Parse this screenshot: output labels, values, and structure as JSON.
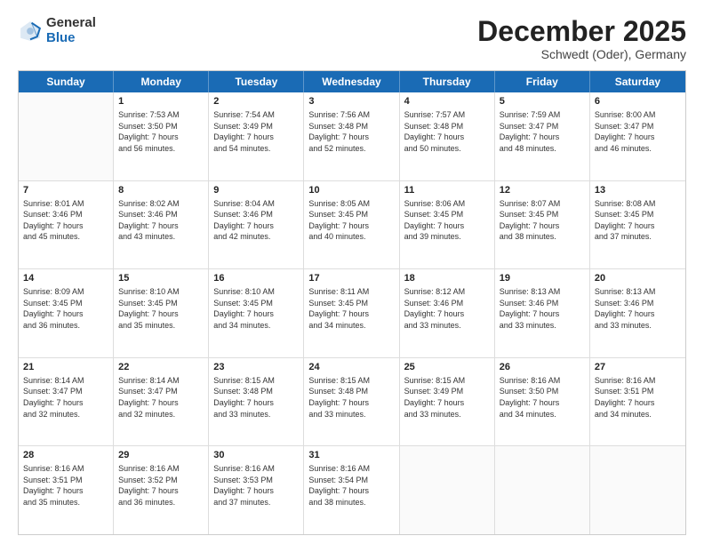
{
  "logo": {
    "general": "General",
    "blue": "Blue"
  },
  "header": {
    "month": "December 2025",
    "location": "Schwedt (Oder), Germany"
  },
  "days": [
    "Sunday",
    "Monday",
    "Tuesday",
    "Wednesday",
    "Thursday",
    "Friday",
    "Saturday"
  ],
  "weeks": [
    [
      {
        "day": "",
        "lines": []
      },
      {
        "day": "1",
        "lines": [
          "Sunrise: 7:53 AM",
          "Sunset: 3:50 PM",
          "Daylight: 7 hours",
          "and 56 minutes."
        ]
      },
      {
        "day": "2",
        "lines": [
          "Sunrise: 7:54 AM",
          "Sunset: 3:49 PM",
          "Daylight: 7 hours",
          "and 54 minutes."
        ]
      },
      {
        "day": "3",
        "lines": [
          "Sunrise: 7:56 AM",
          "Sunset: 3:48 PM",
          "Daylight: 7 hours",
          "and 52 minutes."
        ]
      },
      {
        "day": "4",
        "lines": [
          "Sunrise: 7:57 AM",
          "Sunset: 3:48 PM",
          "Daylight: 7 hours",
          "and 50 minutes."
        ]
      },
      {
        "day": "5",
        "lines": [
          "Sunrise: 7:59 AM",
          "Sunset: 3:47 PM",
          "Daylight: 7 hours",
          "and 48 minutes."
        ]
      },
      {
        "day": "6",
        "lines": [
          "Sunrise: 8:00 AM",
          "Sunset: 3:47 PM",
          "Daylight: 7 hours",
          "and 46 minutes."
        ]
      }
    ],
    [
      {
        "day": "7",
        "lines": [
          "Sunrise: 8:01 AM",
          "Sunset: 3:46 PM",
          "Daylight: 7 hours",
          "and 45 minutes."
        ]
      },
      {
        "day": "8",
        "lines": [
          "Sunrise: 8:02 AM",
          "Sunset: 3:46 PM",
          "Daylight: 7 hours",
          "and 43 minutes."
        ]
      },
      {
        "day": "9",
        "lines": [
          "Sunrise: 8:04 AM",
          "Sunset: 3:46 PM",
          "Daylight: 7 hours",
          "and 42 minutes."
        ]
      },
      {
        "day": "10",
        "lines": [
          "Sunrise: 8:05 AM",
          "Sunset: 3:45 PM",
          "Daylight: 7 hours",
          "and 40 minutes."
        ]
      },
      {
        "day": "11",
        "lines": [
          "Sunrise: 8:06 AM",
          "Sunset: 3:45 PM",
          "Daylight: 7 hours",
          "and 39 minutes."
        ]
      },
      {
        "day": "12",
        "lines": [
          "Sunrise: 8:07 AM",
          "Sunset: 3:45 PM",
          "Daylight: 7 hours",
          "and 38 minutes."
        ]
      },
      {
        "day": "13",
        "lines": [
          "Sunrise: 8:08 AM",
          "Sunset: 3:45 PM",
          "Daylight: 7 hours",
          "and 37 minutes."
        ]
      }
    ],
    [
      {
        "day": "14",
        "lines": [
          "Sunrise: 8:09 AM",
          "Sunset: 3:45 PM",
          "Daylight: 7 hours",
          "and 36 minutes."
        ]
      },
      {
        "day": "15",
        "lines": [
          "Sunrise: 8:10 AM",
          "Sunset: 3:45 PM",
          "Daylight: 7 hours",
          "and 35 minutes."
        ]
      },
      {
        "day": "16",
        "lines": [
          "Sunrise: 8:10 AM",
          "Sunset: 3:45 PM",
          "Daylight: 7 hours",
          "and 34 minutes."
        ]
      },
      {
        "day": "17",
        "lines": [
          "Sunrise: 8:11 AM",
          "Sunset: 3:45 PM",
          "Daylight: 7 hours",
          "and 34 minutes."
        ]
      },
      {
        "day": "18",
        "lines": [
          "Sunrise: 8:12 AM",
          "Sunset: 3:46 PM",
          "Daylight: 7 hours",
          "and 33 minutes."
        ]
      },
      {
        "day": "19",
        "lines": [
          "Sunrise: 8:13 AM",
          "Sunset: 3:46 PM",
          "Daylight: 7 hours",
          "and 33 minutes."
        ]
      },
      {
        "day": "20",
        "lines": [
          "Sunrise: 8:13 AM",
          "Sunset: 3:46 PM",
          "Daylight: 7 hours",
          "and 33 minutes."
        ]
      }
    ],
    [
      {
        "day": "21",
        "lines": [
          "Sunrise: 8:14 AM",
          "Sunset: 3:47 PM",
          "Daylight: 7 hours",
          "and 32 minutes."
        ]
      },
      {
        "day": "22",
        "lines": [
          "Sunrise: 8:14 AM",
          "Sunset: 3:47 PM",
          "Daylight: 7 hours",
          "and 32 minutes."
        ]
      },
      {
        "day": "23",
        "lines": [
          "Sunrise: 8:15 AM",
          "Sunset: 3:48 PM",
          "Daylight: 7 hours",
          "and 33 minutes."
        ]
      },
      {
        "day": "24",
        "lines": [
          "Sunrise: 8:15 AM",
          "Sunset: 3:48 PM",
          "Daylight: 7 hours",
          "and 33 minutes."
        ]
      },
      {
        "day": "25",
        "lines": [
          "Sunrise: 8:15 AM",
          "Sunset: 3:49 PM",
          "Daylight: 7 hours",
          "and 33 minutes."
        ]
      },
      {
        "day": "26",
        "lines": [
          "Sunrise: 8:16 AM",
          "Sunset: 3:50 PM",
          "Daylight: 7 hours",
          "and 34 minutes."
        ]
      },
      {
        "day": "27",
        "lines": [
          "Sunrise: 8:16 AM",
          "Sunset: 3:51 PM",
          "Daylight: 7 hours",
          "and 34 minutes."
        ]
      }
    ],
    [
      {
        "day": "28",
        "lines": [
          "Sunrise: 8:16 AM",
          "Sunset: 3:51 PM",
          "Daylight: 7 hours",
          "and 35 minutes."
        ]
      },
      {
        "day": "29",
        "lines": [
          "Sunrise: 8:16 AM",
          "Sunset: 3:52 PM",
          "Daylight: 7 hours",
          "and 36 minutes."
        ]
      },
      {
        "day": "30",
        "lines": [
          "Sunrise: 8:16 AM",
          "Sunset: 3:53 PM",
          "Daylight: 7 hours",
          "and 37 minutes."
        ]
      },
      {
        "day": "31",
        "lines": [
          "Sunrise: 8:16 AM",
          "Sunset: 3:54 PM",
          "Daylight: 7 hours",
          "and 38 minutes."
        ]
      },
      {
        "day": "",
        "lines": []
      },
      {
        "day": "",
        "lines": []
      },
      {
        "day": "",
        "lines": []
      }
    ]
  ]
}
